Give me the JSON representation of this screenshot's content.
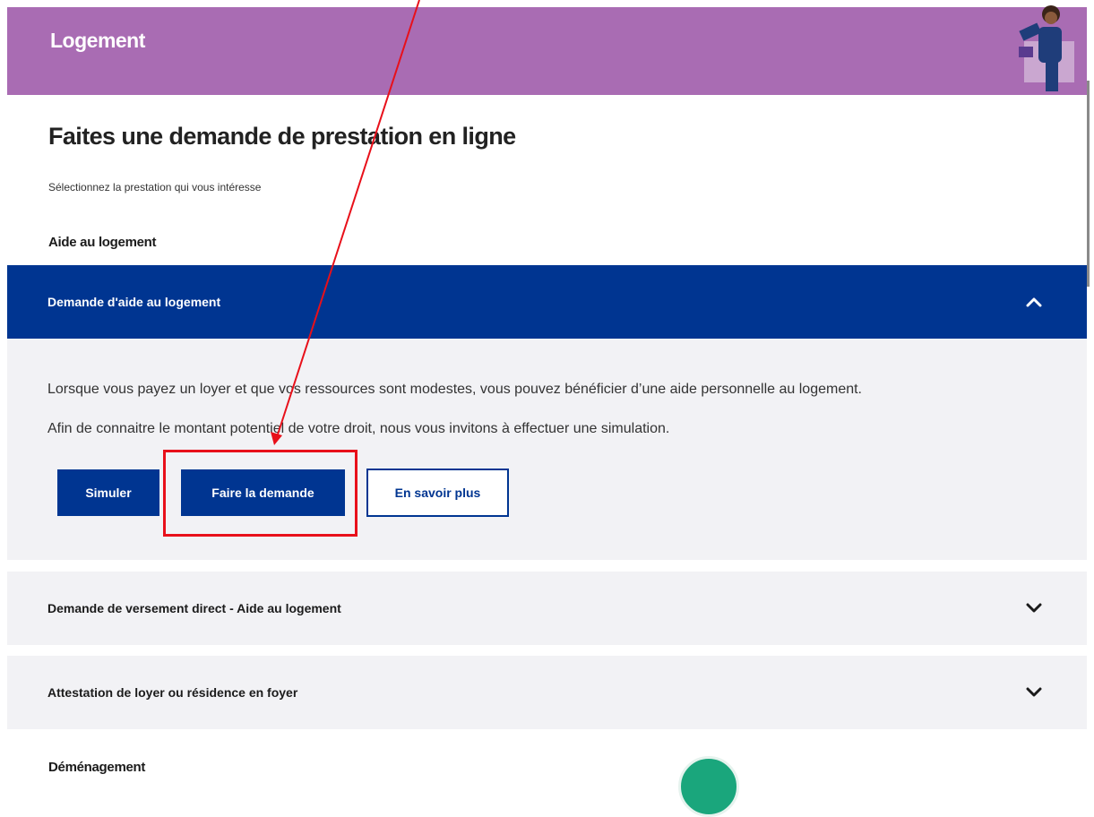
{
  "banner": {
    "title": "Logement",
    "color": "#a96cb3"
  },
  "page": {
    "title": "Faites une demande de prestation en ligne",
    "subtitle": "Sélectionnez la prestation qui vous intéresse"
  },
  "sections": [
    {
      "title": "Aide au logement",
      "items": [
        {
          "label": "Demande d'aide au logement",
          "expanded": true,
          "paragraphs": [
            "Lorsque vous payez un loyer et que vos ressources sont modestes, vous pouvez bénéficier d’une aide personnelle au logement.",
            "Afin de connaitre le montant potentiel de votre droit, nous vous invitons à effectuer une simulation."
          ],
          "buttons": {
            "simulate": "Simuler",
            "apply": "Faire la demande",
            "more": "En savoir plus"
          }
        },
        {
          "label": "Demande de versement direct - Aide au logement",
          "expanded": false
        },
        {
          "label": "Attestation de loyer ou résidence en foyer",
          "expanded": false
        }
      ]
    },
    {
      "title": "Déménagement"
    }
  ],
  "colors": {
    "primary": "#003591",
    "panel": "#f2f2f5",
    "highlight": "#e8101a",
    "chat": "#1aa67c"
  },
  "icons": {
    "expand": "chevron-up-icon",
    "collapse": "chevron-down-icon"
  }
}
